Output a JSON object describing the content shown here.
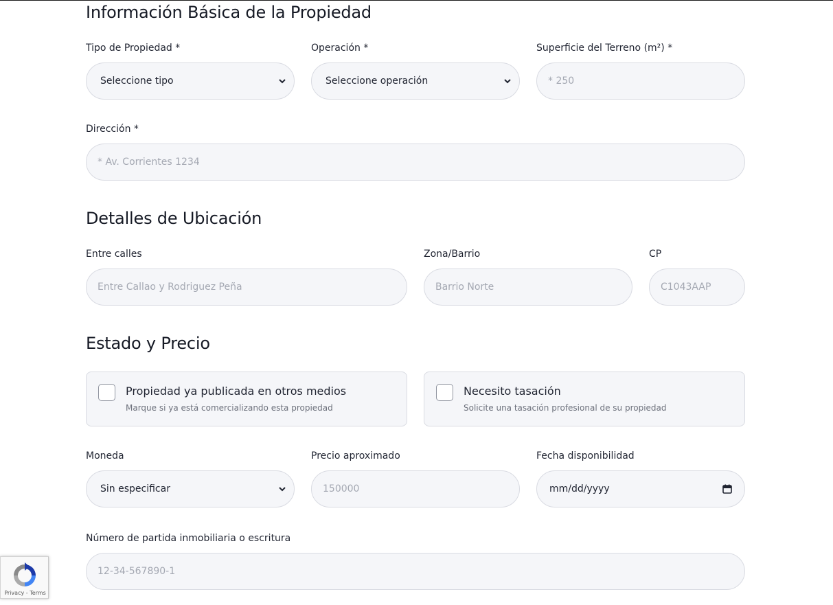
{
  "sections": {
    "basic_info": "Información Básica de la Propiedad",
    "location": "Detalles de Ubicación",
    "status_price": "Estado y Precio"
  },
  "fields": {
    "property_type": {
      "label": "Tipo de Propiedad *",
      "value": "Seleccione tipo"
    },
    "operation": {
      "label": "Operación *",
      "value": "Seleccione operación"
    },
    "land_area": {
      "label": "Superficie del Terreno (m²) *",
      "placeholder": "* 250"
    },
    "address": {
      "label": "Dirección *",
      "placeholder": "* Av. Corrientes 1234"
    },
    "between_streets": {
      "label": "Entre calles",
      "placeholder": "Entre Callao y Rodriguez Peña"
    },
    "neighborhood": {
      "label": "Zona/Barrio",
      "placeholder": "Barrio Norte"
    },
    "postal_code": {
      "label": "CP",
      "placeholder": "C1043AAP"
    },
    "currency": {
      "label": "Moneda",
      "value": "Sin especificar"
    },
    "price": {
      "label": "Precio aproximado",
      "placeholder": "150000"
    },
    "availability_date": {
      "label": "Fecha disponibilidad",
      "value": "mm/dd/yyyy"
    },
    "deed_number": {
      "label": "Número de partida inmobiliaria o escritura",
      "placeholder": "12-34-567890-1"
    }
  },
  "checkboxes": {
    "already_published": {
      "title": "Propiedad ya publicada en otros medios",
      "subtitle": "Marque si ya está comercializando esta propiedad",
      "checked": false
    },
    "need_appraisal": {
      "title": "Necesito tasación",
      "subtitle": "Solicite una tasación profesional de su propiedad",
      "checked": false
    }
  },
  "recaptcha": {
    "privacy": "Privacy",
    "separator": " - ",
    "terms": "Terms"
  },
  "colors": {
    "field_bg": "#f5f6f9",
    "field_border": "#d9dbe2",
    "placeholder": "#a4a8b2",
    "heading": "#161a25"
  }
}
